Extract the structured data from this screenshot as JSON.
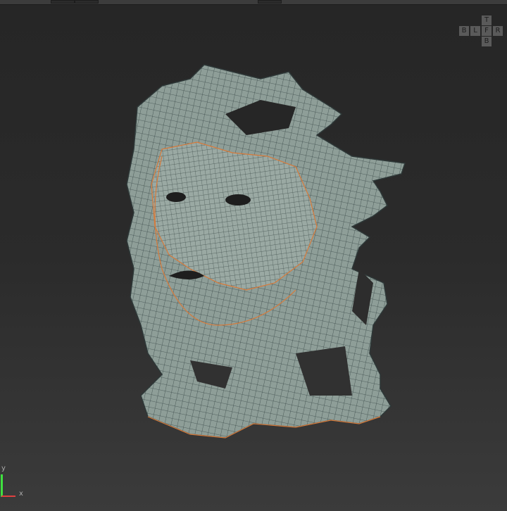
{
  "viewcube": {
    "top": "T",
    "back": "B",
    "left": "L",
    "front": "F",
    "right": "R",
    "bottom": "B"
  },
  "axis_gizmo": {
    "x_label": "x",
    "y_label": "y"
  },
  "colors": {
    "mesh": "#8e9e98",
    "wire": "#3c4a4a",
    "seam": "#d77a3a",
    "x_axis": "#e04040",
    "y_axis": "#40e040"
  }
}
